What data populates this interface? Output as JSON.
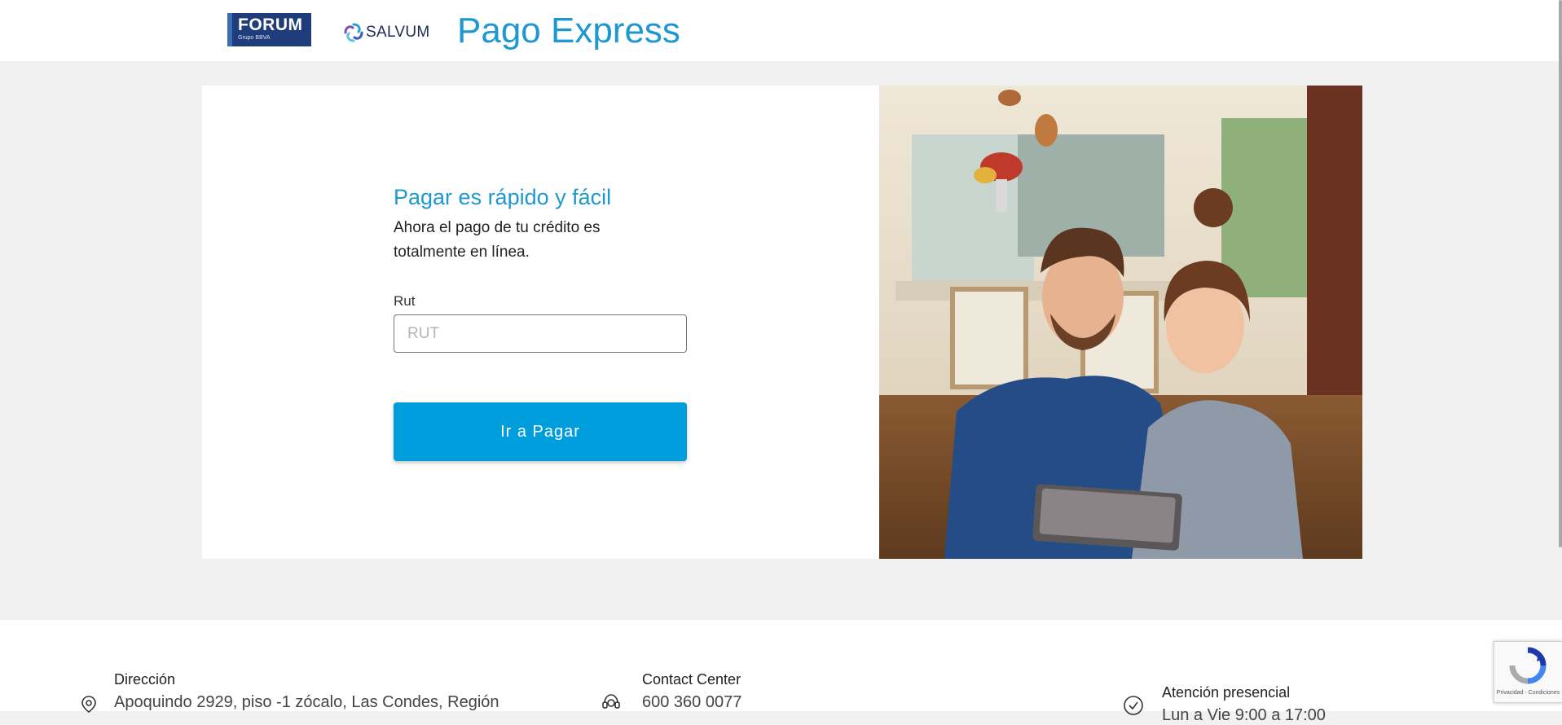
{
  "header": {
    "forum_logo": {
      "name": "FORUM",
      "tagline": "Grupo BBVA"
    },
    "salvum_logo": {
      "name": "SALVUM"
    },
    "title": "Pago Express"
  },
  "form": {
    "title": "Pagar es rápido y fácil",
    "description": "Ahora el pago de tu crédito es totalmente en línea.",
    "rut_label": "Rut",
    "rut_placeholder": "RUT",
    "rut_value": "",
    "submit_label": "Ir a Pagar"
  },
  "footer": {
    "address": {
      "label": "Dirección",
      "value": "Apoquindo 2929, piso -1 zócalo, Las Condes, Región",
      "icon": "location-pin-icon"
    },
    "contact": {
      "label": "Contact Center",
      "value": "600 360 0077",
      "icon": "headset-icon"
    },
    "attention": {
      "label": "Atención presencial",
      "value": "Lun a Vie 9:00 a 17:00",
      "icon": "clock-icon"
    }
  },
  "recaptcha": {
    "caption": "Privacidad - Condiciones"
  },
  "colors": {
    "brand_blue": "#1e98d0",
    "button_blue": "#009ddd",
    "forum_navy": "#1f3d7a"
  }
}
